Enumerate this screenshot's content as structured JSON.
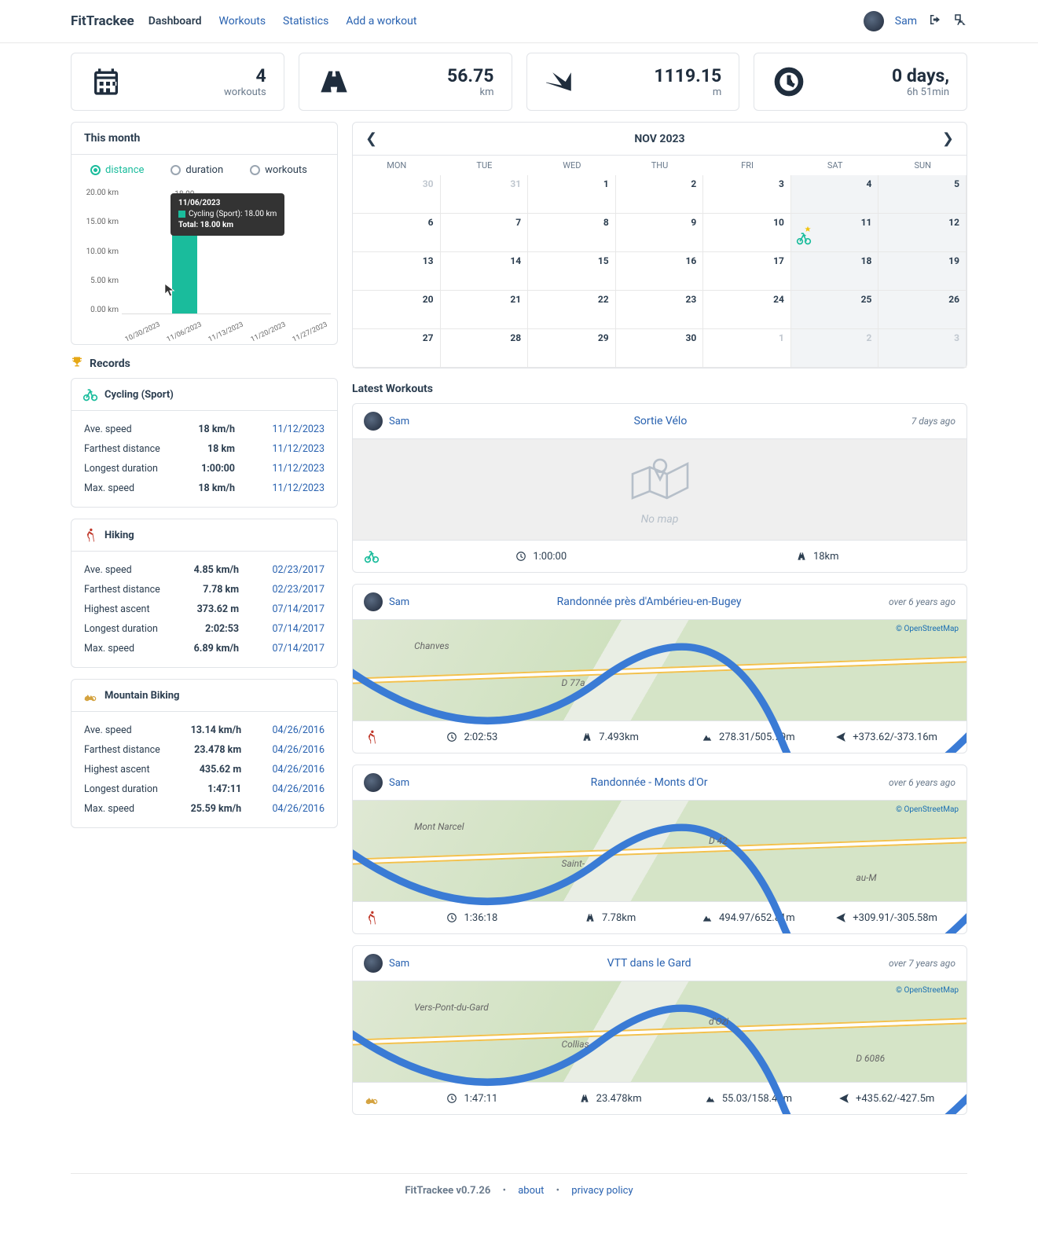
{
  "app": {
    "name": "FitTrackee",
    "version_label": "FitTrackee v0.7.26"
  },
  "nav": {
    "dashboard": "Dashboard",
    "workouts": "Workouts",
    "statistics": "Statistics",
    "add": "Add a workout",
    "username": "Sam"
  },
  "stats": {
    "workouts": {
      "value": "4",
      "unit": "workouts"
    },
    "distance": {
      "value": "56.75",
      "unit": "km"
    },
    "ascent": {
      "value": "1119.15",
      "unit": "m"
    },
    "duration": {
      "value": "0 days,",
      "unit": "6h 51min"
    }
  },
  "monthly": {
    "title": "This month",
    "tabs": {
      "distance": "distance",
      "duration": "duration",
      "workouts": "workouts"
    },
    "tooltip": {
      "date": "11/06/2023",
      "series": "Cycling (Sport): 18.00 km",
      "total": "Total: 18.00 km"
    },
    "bar_top_label": "18.00"
  },
  "chart_data": {
    "type": "bar",
    "title": "This month — distance",
    "categories": [
      "10/30/2023",
      "11/06/2023",
      "11/13/2023",
      "11/20/2023",
      "11/27/2023"
    ],
    "series": [
      {
        "name": "Cycling (Sport)",
        "values": [
          0,
          18.0,
          0,
          0,
          0
        ]
      }
    ],
    "ylabel": "km",
    "y_ticks": [
      "20.00 km",
      "15.00 km",
      "10.00 km",
      "5.00 km",
      "0.00 km"
    ],
    "ylim": [
      0,
      20
    ]
  },
  "records_title": "Records",
  "records": [
    {
      "sport": "Cycling (Sport)",
      "icon": "cyc",
      "rows": [
        {
          "label": "Ave. speed",
          "value": "18 km/h",
          "date": "11/12/2023"
        },
        {
          "label": "Farthest distance",
          "value": "18 km",
          "date": "11/12/2023"
        },
        {
          "label": "Longest duration",
          "value": "1:00:00",
          "date": "11/12/2023"
        },
        {
          "label": "Max. speed",
          "value": "18 km/h",
          "date": "11/12/2023"
        }
      ]
    },
    {
      "sport": "Hiking",
      "icon": "hik",
      "rows": [
        {
          "label": "Ave. speed",
          "value": "4.85 km/h",
          "date": "02/23/2017"
        },
        {
          "label": "Farthest distance",
          "value": "7.78 km",
          "date": "02/23/2017"
        },
        {
          "label": "Highest ascent",
          "value": "373.62 m",
          "date": "07/14/2017"
        },
        {
          "label": "Longest duration",
          "value": "2:02:53",
          "date": "07/14/2017"
        },
        {
          "label": "Max. speed",
          "value": "6.89 km/h",
          "date": "07/14/2017"
        }
      ]
    },
    {
      "sport": "Mountain Biking",
      "icon": "mtb",
      "rows": [
        {
          "label": "Ave. speed",
          "value": "13.14 km/h",
          "date": "04/26/2016"
        },
        {
          "label": "Farthest distance",
          "value": "23.478 km",
          "date": "04/26/2016"
        },
        {
          "label": "Highest ascent",
          "value": "435.62 m",
          "date": "04/26/2016"
        },
        {
          "label": "Longest duration",
          "value": "1:47:11",
          "date": "04/26/2016"
        },
        {
          "label": "Max. speed",
          "value": "25.59 km/h",
          "date": "04/26/2016"
        }
      ]
    }
  ],
  "calendar": {
    "month_label": "NOV 2023",
    "day_names": [
      "MON",
      "TUE",
      "WED",
      "THU",
      "FRI",
      "SAT",
      "SUN"
    ],
    "cells": [
      {
        "d": "30",
        "other": true
      },
      {
        "d": "31",
        "other": true
      },
      {
        "d": "1"
      },
      {
        "d": "2"
      },
      {
        "d": "3"
      },
      {
        "d": "4",
        "weekend": true
      },
      {
        "d": "5",
        "weekend": true
      },
      {
        "d": "6"
      },
      {
        "d": "7"
      },
      {
        "d": "8"
      },
      {
        "d": "9"
      },
      {
        "d": "10"
      },
      {
        "d": "11",
        "weekend": true,
        "workout": true
      },
      {
        "d": "12",
        "weekend": true
      },
      {
        "d": "13"
      },
      {
        "d": "14"
      },
      {
        "d": "15"
      },
      {
        "d": "16"
      },
      {
        "d": "17"
      },
      {
        "d": "18",
        "weekend": true
      },
      {
        "d": "19",
        "weekend": true
      },
      {
        "d": "20"
      },
      {
        "d": "21"
      },
      {
        "d": "22"
      },
      {
        "d": "23"
      },
      {
        "d": "24"
      },
      {
        "d": "25",
        "weekend": true
      },
      {
        "d": "26",
        "weekend": true
      },
      {
        "d": "27"
      },
      {
        "d": "28"
      },
      {
        "d": "29"
      },
      {
        "d": "30"
      },
      {
        "d": "1",
        "other": true
      },
      {
        "d": "2",
        "other": true,
        "weekend": true
      },
      {
        "d": "3",
        "other": true,
        "weekend": true
      }
    ]
  },
  "latest_title": "Latest Workouts",
  "osm_credit": "© OpenStreetMap",
  "nomap_label": "No map",
  "workouts": [
    {
      "user": "Sam",
      "title": "Sortie Vélo",
      "ago": "7 days ago",
      "map": "none",
      "sport": "cyc",
      "stats": {
        "duration": "1:00:00",
        "distance": "18km"
      }
    },
    {
      "user": "Sam",
      "title": "Randonnée près d'Ambérieu-en-Bugey",
      "ago": "over 6 years ago",
      "map": "osm",
      "sport": "hik",
      "places": [
        "Chanves",
        "D 77a"
      ],
      "stats": {
        "duration": "2:02:53",
        "distance": "7.493km",
        "elev": "278.31/505.79m",
        "ascent": "+373.62/-373.16m"
      }
    },
    {
      "user": "Sam",
      "title": "Randonnée - Monts d'Or",
      "ago": "over 6 years ago",
      "map": "osm",
      "sport": "hik",
      "places": [
        "Mont Narcel",
        "Saint-",
        "D 42",
        "au-M"
      ],
      "stats": {
        "duration": "1:36:18",
        "distance": "7.78km",
        "elev": "494.97/652.81m",
        "ascent": "+309.91/-305.58m"
      }
    },
    {
      "user": "Sam",
      "title": "VTT dans le Gard",
      "ago": "over 7 years ago",
      "map": "osm",
      "sport": "mtb",
      "places": [
        "Vers-Pont-du-Gard",
        "Collias",
        "d'Ozi",
        "D 6086"
      ],
      "stats": {
        "duration": "1:47:11",
        "distance": "23.478km",
        "elev": "55.03/158.41m",
        "ascent": "+435.62/-427.5m"
      }
    }
  ],
  "footer": {
    "about": "about",
    "privacy": "privacy policy"
  }
}
